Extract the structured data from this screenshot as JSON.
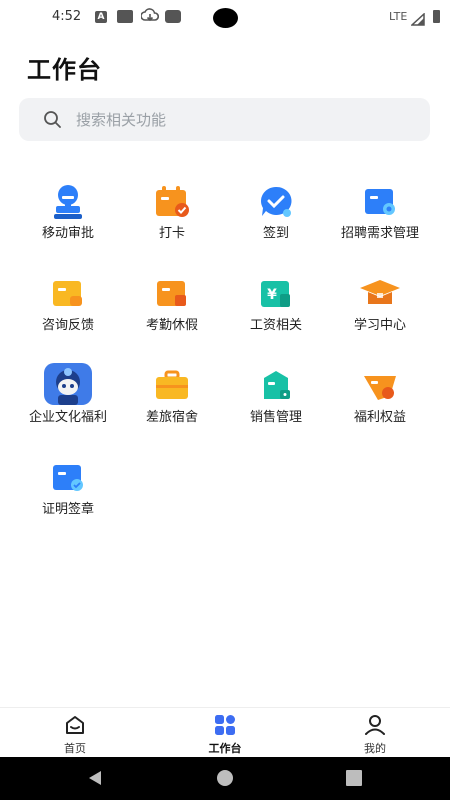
{
  "status_bar": {
    "time": "4:52",
    "network": "LTE"
  },
  "page": {
    "title": "工作台"
  },
  "search": {
    "placeholder": "搜索相关功能"
  },
  "grid_items": [
    {
      "label": "移动审批",
      "icon": "stamp-icon"
    },
    {
      "label": "打卡",
      "icon": "calendar-check-icon"
    },
    {
      "label": "签到",
      "icon": "check-bubble-icon"
    },
    {
      "label": "招聘需求管理",
      "icon": "recruit-card-icon"
    },
    {
      "label": "咨询反馈",
      "icon": "feedback-card-icon"
    },
    {
      "label": "考勤休假",
      "icon": "attendance-card-icon"
    },
    {
      "label": "工资相关",
      "icon": "salary-icon"
    },
    {
      "label": "学习中心",
      "icon": "graduation-cap-icon"
    },
    {
      "label": "企业文化福利",
      "icon": "mascot-icon"
    },
    {
      "label": "差旅宿舍",
      "icon": "suitcase-icon"
    },
    {
      "label": "销售管理",
      "icon": "sales-bag-icon"
    },
    {
      "label": "福利权益",
      "icon": "benefit-tag-icon"
    },
    {
      "label": "证明签章",
      "icon": "certificate-card-icon"
    }
  ],
  "bottom_nav": {
    "home": "首页",
    "workbench": "工作台",
    "mine": "我的",
    "active": "workbench"
  },
  "colors": {
    "blue": "#2d7ff9",
    "orange": "#f7931e",
    "yellow": "#f9b823",
    "teal": "#18c1a6",
    "active_nav": "#3d6df2"
  }
}
